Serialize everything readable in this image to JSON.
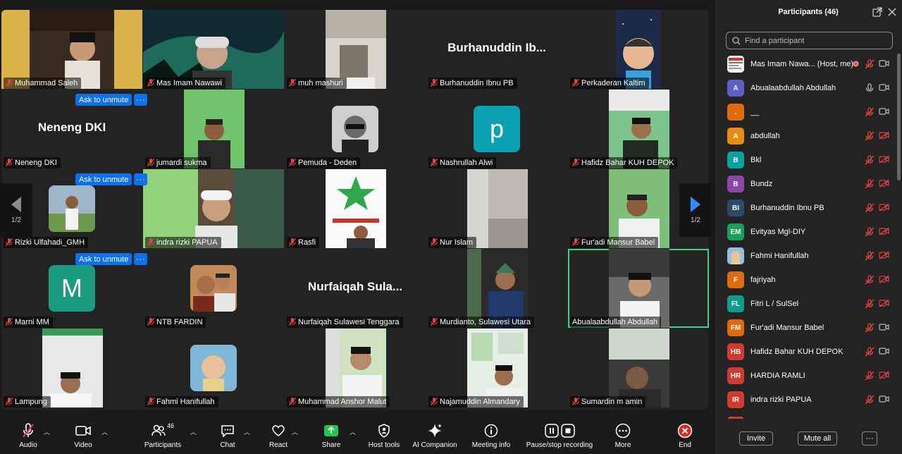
{
  "gallery": {
    "page_indicator_left": "1/2",
    "page_indicator_right": "1/2",
    "ask_to_unmute_label": "Ask to unmute",
    "more_label": "···",
    "tiles": [
      {
        "name": "Muhammad Saleh"
      },
      {
        "name": "Mas Imam Nawawi"
      },
      {
        "name": "muh mashuri"
      },
      {
        "name": "Burhanuddin Ibnu PB",
        "big_name": "Burhanuddin Ib..."
      },
      {
        "name": "Perkaderan Kaltim"
      },
      {
        "name": "Neneng DKI",
        "big_name": "Neneng DKI"
      },
      {
        "name": "jumardi sukma"
      },
      {
        "name": "Pemuda - Deden"
      },
      {
        "name": "Nashrullah Alwi",
        "letter": "p",
        "letter_color": "#0aa1b5"
      },
      {
        "name": "Hafidz Bahar KUH DEPOK"
      },
      {
        "name": "Rizki Ulfahadi_GMH"
      },
      {
        "name": "indra rizki PAPUA"
      },
      {
        "name": "Rasfi"
      },
      {
        "name": "Nur Islam"
      },
      {
        "name": "Fur'adi Mansur Babel"
      },
      {
        "name": "Marni MM",
        "letter": "M",
        "letter_color": "#1b9b7f"
      },
      {
        "name": "NTB FARDIN"
      },
      {
        "name": "Nurfaiqah Sulawesi Tenggara",
        "big_name": "Nurfaiqah Sula..."
      },
      {
        "name": "Murdianto, Sulawesi Utara"
      },
      {
        "name": "Abualaabdullah Abdullah"
      },
      {
        "name": "Lampung"
      },
      {
        "name": "Fahmi Hanifullah"
      },
      {
        "name": "Muhammad Anshor Malut"
      },
      {
        "name": "Najamuddin Almandary"
      },
      {
        "name": "Sumardin m amin"
      }
    ]
  },
  "toolbar": {
    "audio": "Audio",
    "video": "Video",
    "participants": "Participants",
    "participants_count": "46",
    "chat": "Chat",
    "react": "React",
    "share": "Share",
    "host_tools": "Host tools",
    "ai_companion": "AI Companion",
    "meeting_info": "Meeting info",
    "recording": "Pause/stop recording",
    "more": "More",
    "end": "End"
  },
  "panel": {
    "title": "Participants (46)",
    "search_placeholder": "Find a participant",
    "invite": "Invite",
    "mute_all": "Mute all",
    "more": "···",
    "participants": [
      {
        "name": "Mas Imam Nawa...  (Host, me)",
        "initials": "",
        "color": "#e8e8e8"
      },
      {
        "name": "Abualaabdullah Abdullah",
        "initials": "A",
        "color": "#5b5fc7"
      },
      {
        "name": "__",
        "initials": ".",
        "color": "#e06b0c"
      },
      {
        "name": "abdullah",
        "initials": "A",
        "color": "#e88d10"
      },
      {
        "name": "Bkl",
        "initials": "B",
        "color": "#0aa1a1"
      },
      {
        "name": "Bundz",
        "initials": "B",
        "color": "#8e44ad"
      },
      {
        "name": "Burhanuddin Ibnu PB",
        "initials": "BI",
        "color": "#2e4a6b"
      },
      {
        "name": "Evityas Mgl-DIY",
        "initials": "EM",
        "color": "#18a05a"
      },
      {
        "name": "Fahmi Hanifullah",
        "initials": "",
        "color": "#7fa7c9"
      },
      {
        "name": "fajriyah",
        "initials": "F",
        "color": "#e06b0c"
      },
      {
        "name": "Fitri L / SulSel",
        "initials": "FL",
        "color": "#0f9c8a"
      },
      {
        "name": "Fur'adi Mansur Babel",
        "initials": "FM",
        "color": "#e06b0c"
      },
      {
        "name": "Hafidz Bahar KUH DEPOK",
        "initials": "HB",
        "color": "#d13b2f"
      },
      {
        "name": "HARDIA RAMLI",
        "initials": "HR",
        "color": "#d13b2f"
      },
      {
        "name": "indra rizki PAPUA",
        "initials": "IR",
        "color": "#d13b2f"
      }
    ]
  }
}
